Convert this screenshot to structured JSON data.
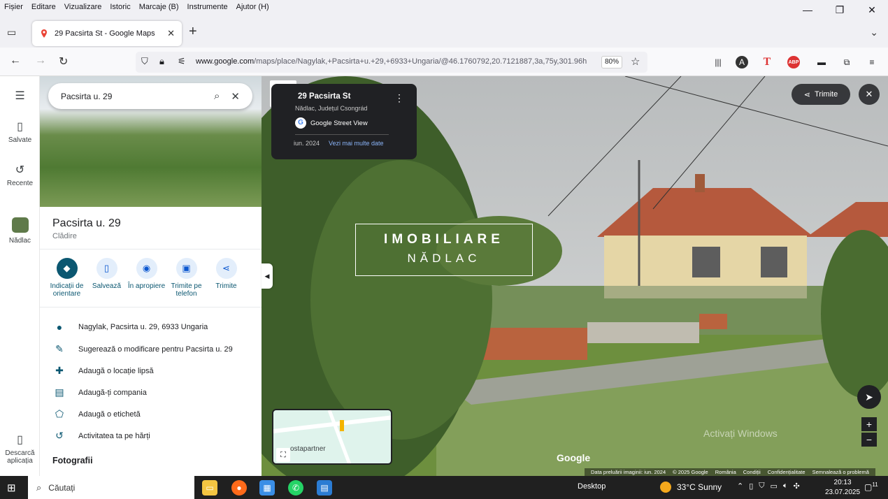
{
  "menu": [
    "Fișier",
    "Editare",
    "Vizualizare",
    "Istoric",
    "Marcaje (B)",
    "Instrumente",
    "Ajutor (H)"
  ],
  "window_controls": {
    "minimize": "—",
    "restore": "❐",
    "close": "✕"
  },
  "tab": {
    "title": "29 Pacsirta St - Google Maps",
    "close": "✕",
    "new": "+"
  },
  "url": {
    "domain": "www.google.com",
    "path": "/maps/place/Nagylak,+Pacsirta+u.+29,+6933+Ungaria/@46.1760792,20.7121887,3a,75y,301.96h",
    "zoom": "80%"
  },
  "extensions": {
    "abp": "ABP",
    "t": "T",
    "a": "A"
  },
  "rail": {
    "menu_icon": "menu-icon",
    "saved": "Salvate",
    "recent": "Recente",
    "place": "Nădlac",
    "download": "Descarcă aplicația"
  },
  "search": {
    "value": "Pacsirta u. 29"
  },
  "place": {
    "name": "Pacsirta u. 29",
    "type": "Clădire"
  },
  "actions": [
    {
      "label": "Indicații de orientare",
      "icon": "◆"
    },
    {
      "label": "Salvează",
      "icon": "▯"
    },
    {
      "label": "În apropiere",
      "icon": "◉"
    },
    {
      "label": "Trimite pe telefon",
      "icon": "▣"
    },
    {
      "label": "Trimite",
      "icon": "⋖"
    }
  ],
  "info": [
    {
      "text": "Nagylak, Pacsirta u. 29, 6933 Ungaria",
      "icon": "●"
    },
    {
      "text": "Sugerează o modificare pentru Pacsirta u. 29",
      "icon": "✎"
    },
    {
      "text": "Adaugă o locație lipsă",
      "icon": "✚"
    },
    {
      "text": "Adaugă-ți compania",
      "icon": "▤"
    },
    {
      "text": "Adaugă o etichetă",
      "icon": "⬠"
    },
    {
      "text": "Activitatea ta pe hărți",
      "icon": "↺"
    }
  ],
  "photos_heading": "Fotografii",
  "streetview": {
    "title": "29 Pacsirta St",
    "subtitle": "Nădlac, Județul Csongrád",
    "gsv": "Google Street View",
    "date": "iun. 2024",
    "more": "Vezi mai multe date",
    "share": "Trimite",
    "watermark1": "IMOBILIARE",
    "watermark2": "NĂDLAC",
    "minimap_label": "ostapartner",
    "google": "Google",
    "attrib": [
      "Data preluării imaginii: iun. 2024",
      "© 2025 Google",
      "România",
      "Condiții",
      "Confidențialitate",
      "Semnalează o problemă"
    ],
    "activate": "Activați Windows"
  },
  "taskbar": {
    "search": "Căutați",
    "desktop": "Desktop",
    "weather": "33°C  Sunny",
    "time": "20:13",
    "date": "23.07.2025",
    "notif": "11"
  }
}
